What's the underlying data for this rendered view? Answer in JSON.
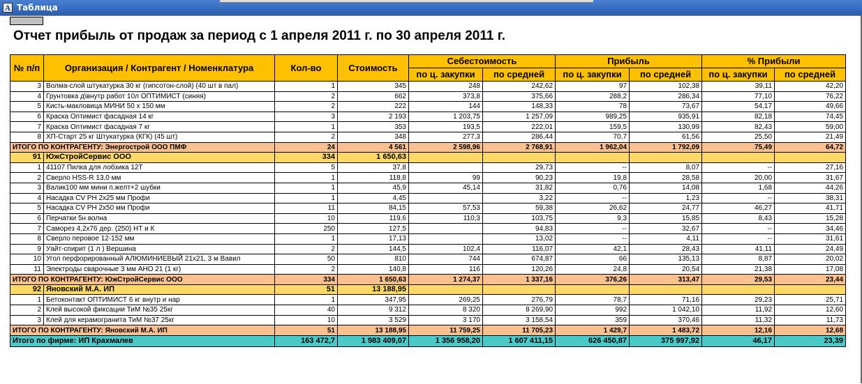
{
  "window": {
    "title": "Таблица",
    "icon": "text-document-icon"
  },
  "report": {
    "title": "Отчет прибыль от продаж за период с 1 апреля 2011 г. по 30 апреля 2011 г.",
    "headers": {
      "num": "№ п/п",
      "org": "Организация / Контрагент / Номенклатура",
      "qty": "Кол-во",
      "cost": "Стоимость",
      "sebest": "Себестоимость",
      "profit": "Прибыль",
      "pct": "% Прибыли",
      "purchase": "по ц. закупки",
      "avg": "по средней"
    },
    "rows": [
      {
        "type": "item",
        "cells": [
          "3",
          "Волма-слой штукатурка 30 кг (гипсотон-слой) (40 шт в пал)",
          "1",
          "345",
          "248",
          "242,62",
          "97",
          "102,38",
          "39,11",
          "42,20"
        ]
      },
      {
        "type": "item",
        "cells": [
          "4",
          "Грунтовка д\\внутр работ 10л ОПТИМИСТ (синяя)",
          "2",
          "662",
          "373,8",
          "375,66",
          "288,2",
          "286,34",
          "77,10",
          "76,22"
        ]
      },
      {
        "type": "item",
        "cells": [
          "5",
          "Кисть-макловица МИНИ 50 х 150 мм",
          "2",
          "222",
          "144",
          "148,33",
          "78",
          "73,67",
          "54,17",
          "49,66"
        ]
      },
      {
        "type": "item",
        "cells": [
          "6",
          "Краска Оптимист  фасадная  14 кг",
          "3",
          "2 193",
          "1 203,75",
          "1 257,09",
          "989,25",
          "935,91",
          "82,18",
          "74,45"
        ]
      },
      {
        "type": "item",
        "cells": [
          "7",
          "Краска Оптимист  фасадная  7 кг",
          "1",
          "353",
          "193,5",
          "222,01",
          "159,5",
          "130,99",
          "82,43",
          "59,00"
        ]
      },
      {
        "type": "item",
        "cells": [
          "8",
          "ХП-Старт 25 кг Штукатурка (КГК) (45 шт)",
          "2",
          "348",
          "277,3",
          "286,44",
          "70,7",
          "61,56",
          "25,50",
          "21,49"
        ]
      },
      {
        "type": "sub",
        "label": "ИТОГО ПО КОНТРАГЕНТУ: Энергострой ООО ПМФ",
        "cells": [
          "24",
          "4 561",
          "2 598,96",
          "2 768,91",
          "1 962,04",
          "1 792,09",
          "75,49",
          "64,72"
        ]
      },
      {
        "type": "grp",
        "cells": [
          "91",
          "ЮжСтройСервис ООО",
          "334",
          "1 650,63"
        ]
      },
      {
        "type": "item",
        "cells": [
          "1",
          "41107 Пилка для лобзика  12Т",
          "5",
          "37,8",
          "",
          "29,73",
          "--",
          "8,07",
          "--",
          "27,16"
        ]
      },
      {
        "type": "item",
        "cells": [
          "2",
          "Сверло HSS-R 13,0 мм",
          "1",
          "118,8",
          "99",
          "90,23",
          "19,8",
          "28,58",
          "20,00",
          "31,67"
        ]
      },
      {
        "type": "item",
        "cells": [
          "3",
          "Валик100 мм мини п.желт+2 шубки",
          "1",
          "45,9",
          "45,14",
          "31,82",
          "0,76",
          "14,08",
          "1,68",
          "44,26"
        ]
      },
      {
        "type": "item",
        "cells": [
          "4",
          "Насадка CV PH 2x25 мм Профи",
          "1",
          "4,45",
          "",
          "3,22",
          "--",
          "1,23",
          "--",
          "38,31"
        ]
      },
      {
        "type": "item",
        "cells": [
          "5",
          "Насадка CV PH 2x50 мм Профи",
          "11",
          "84,15",
          "57,53",
          "59,38",
          "26,62",
          "24,77",
          "46,27",
          "41,71"
        ]
      },
      {
        "type": "item",
        "cells": [
          "6",
          "Перчатки 5н волна",
          "10",
          "119,6",
          "110,3",
          "103,75",
          "9,3",
          "15,85",
          "8,43",
          "15,28"
        ]
      },
      {
        "type": "item",
        "cells": [
          "7",
          "Саморез  4,2х76 дер. (250) НТ и К",
          "250",
          "127,5",
          "",
          "94,83",
          "--",
          "32,67",
          "--",
          "34,46"
        ]
      },
      {
        "type": "item",
        "cells": [
          "8",
          "Сверло перовое 12-152 мм",
          "1",
          "17,13",
          "",
          "13,02",
          "--",
          "4,11",
          "--",
          "31,61"
        ]
      },
      {
        "type": "item",
        "cells": [
          "9",
          "Уайт-спирит (1 л ) Вершина",
          "2",
          "144,5",
          "102,4",
          "116,07",
          "42,1",
          "28,43",
          "41,11",
          "24,49"
        ]
      },
      {
        "type": "item",
        "cells": [
          "10",
          "Угол перфорированный  АЛЮМИНИЕВЫЙ 21х21, 3 м Вавил",
          "50",
          "810",
          "744",
          "674,87",
          "66",
          "135,13",
          "8,87",
          "20,02"
        ]
      },
      {
        "type": "item",
        "cells": [
          "11",
          "Электроды сварочные 3 мм АНО 21 (1 кг)",
          "2",
          "140,8",
          "116",
          "120,26",
          "24,8",
          "20,54",
          "21,38",
          "17,08"
        ]
      },
      {
        "type": "sub",
        "label": "ИТОГО ПО КОНТРАГЕНТУ: ЮжСтройСервис ООО",
        "cells": [
          "334",
          "1 650,63",
          "1 274,37",
          "1 337,16",
          "376,26",
          "313,47",
          "29,53",
          "23,44"
        ]
      },
      {
        "type": "grp",
        "cells": [
          "92",
          "Яновский М.А. ИП",
          "51",
          "13 188,95"
        ]
      },
      {
        "type": "item",
        "cells": [
          "1",
          "Бетоконтакт ОПТИМИСТ 6 кг внутр и нар",
          "1",
          "347,95",
          "269,25",
          "276,79",
          "78,7",
          "71,16",
          "29,23",
          "25,71"
        ]
      },
      {
        "type": "item",
        "cells": [
          "2",
          "Клей высокой фиксации ТиМ №35 25кг",
          "40",
          "9 312",
          "8 320",
          "8 269,90",
          "992",
          "1 042,10",
          "11,92",
          "12,60"
        ]
      },
      {
        "type": "item",
        "cells": [
          "3",
          "Клей для керамогранита ТиМ №37 25кг",
          "10",
          "3 529",
          "3 170",
          "3 158,54",
          "359",
          "370,46",
          "11,32",
          "11,73"
        ]
      },
      {
        "type": "sub",
        "label": "ИТОГО ПО КОНТРАГЕНТУ: Яновский М.А. ИП",
        "cells": [
          "51",
          "13 188,95",
          "11 759,25",
          "11 705,23",
          "1 429,7",
          "1 483,72",
          "12,16",
          "12,68"
        ]
      },
      {
        "type": "firm",
        "label": "Итого по фирме: ИП Крахмалев",
        "cells": [
          "163 472,7",
          "1 983 409,07",
          "1 356 958,20",
          "1 607 411,15",
          "626 450,87",
          "375 997,92",
          "46,17",
          "23,39"
        ]
      }
    ]
  },
  "colors": {
    "header": "#ffc000",
    "subtotal": "#fac090",
    "group": "#ffd966",
    "firm_total": "#4bc9c8"
  }
}
